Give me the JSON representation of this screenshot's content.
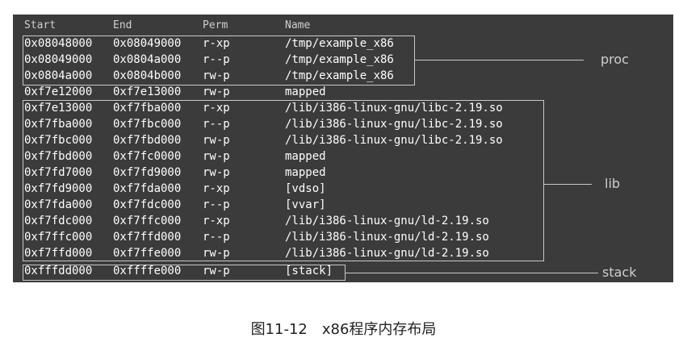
{
  "headers": [
    "Start",
    "End",
    "Perm",
    "Name"
  ],
  "rows": [
    {
      "start": "0x08048000",
      "end": "0x08049000",
      "perm": "r-xp",
      "name": "/tmp/example_x86"
    },
    {
      "start": "0x08049000",
      "end": "0x0804a000",
      "perm": "r--p",
      "name": "/tmp/example_x86"
    },
    {
      "start": "0x0804a000",
      "end": "0x0804b000",
      "perm": "rw-p",
      "name": "/tmp/example_x86"
    },
    {
      "start": "0xf7e12000",
      "end": "0xf7e13000",
      "perm": "rw-p",
      "name": "mapped"
    },
    {
      "start": "0xf7e13000",
      "end": "0xf7fba000",
      "perm": "r-xp",
      "name": "/lib/i386-linux-gnu/libc-2.19.so"
    },
    {
      "start": "0xf7fba000",
      "end": "0xf7fbc000",
      "perm": "r--p",
      "name": "/lib/i386-linux-gnu/libc-2.19.so"
    },
    {
      "start": "0xf7fbc000",
      "end": "0xf7fbd000",
      "perm": "rw-p",
      "name": "/lib/i386-linux-gnu/libc-2.19.so"
    },
    {
      "start": "0xf7fbd000",
      "end": "0xf7fc0000",
      "perm": "rw-p",
      "name": "mapped"
    },
    {
      "start": "0xf7fd7000",
      "end": "0xf7fd9000",
      "perm": "rw-p",
      "name": "mapped"
    },
    {
      "start": "0xf7fd9000",
      "end": "0xf7fda000",
      "perm": "r-xp",
      "name": "[vdso]"
    },
    {
      "start": "0xf7fda000",
      "end": "0xf7fdc000",
      "perm": "r--p",
      "name": "[vvar]"
    },
    {
      "start": "0xf7fdc000",
      "end": "0xf7ffc000",
      "perm": "r-xp",
      "name": "/lib/i386-linux-gnu/ld-2.19.so"
    },
    {
      "start": "0xf7ffc000",
      "end": "0xf7ffd000",
      "perm": "r--p",
      "name": "/lib/i386-linux-gnu/ld-2.19.so"
    },
    {
      "start": "0xf7ffd000",
      "end": "0xf7ffe000",
      "perm": "rw-p",
      "name": "/lib/i386-linux-gnu/ld-2.19.so"
    },
    {
      "start": "0xfffdd000",
      "end": "0xffffe000",
      "perm": "rw-p",
      "name": "[stack]"
    }
  ],
  "groups": {
    "proc": "proc",
    "lib": "lib",
    "stack": "stack"
  },
  "caption": "图11-12　x86程序内存布局",
  "colors": {
    "terminal_bg": "#3b3b3b",
    "text": "#ffffff",
    "bracket": "#c9c9c9",
    "label": "#cfcfcf"
  }
}
